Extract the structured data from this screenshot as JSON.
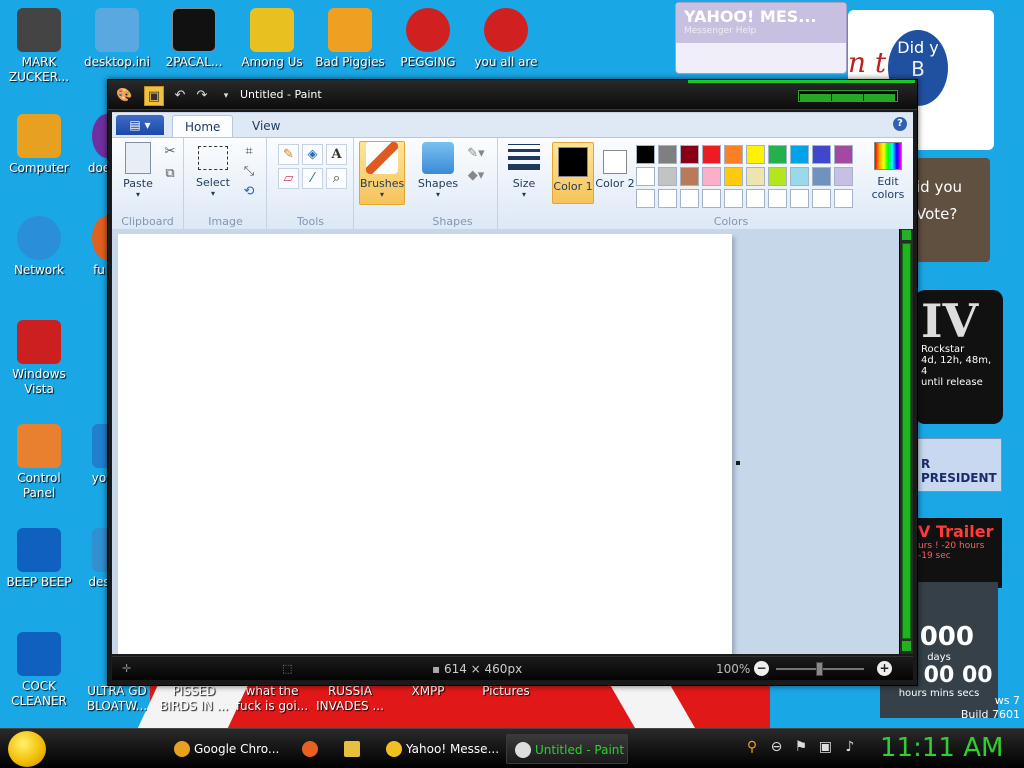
{
  "desktop": {
    "icons_left": [
      {
        "label": "MARK ZUCKER...",
        "color": "#444444"
      },
      {
        "label": "Computer",
        "color": "#e8a020"
      },
      {
        "label": "Network",
        "color": "#2a8fd8"
      },
      {
        "label": "Windows Vista",
        "color": "#cc2020"
      },
      {
        "label": "Control Panel",
        "color": "#e88030"
      },
      {
        "label": "BEEP BEEP",
        "color": "#1060c0"
      },
      {
        "label": "COCK CLEANER",
        "color": "#1060c0"
      }
    ],
    "icons_top": [
      {
        "label": "desktop.ini",
        "color": "#5aa8e0"
      },
      {
        "label": "2PACAL...",
        "color": "#111111"
      },
      {
        "label": "Among Us",
        "color": "#e8c020"
      },
      {
        "label": "Bad Piggies",
        "color": "#f0a020"
      },
      {
        "label": "PEGGING",
        "color": "#d02020"
      },
      {
        "label": "you all are",
        "color": "#d02020"
      }
    ],
    "icons_col2": [
      {
        "label": "doe",
        "color": "#7030a0"
      },
      {
        "label": "fu",
        "color": "#e06020"
      },
      {
        "label": "yo",
        "color": "#2080d0"
      },
      {
        "label": "des",
        "color": "#3090d0"
      }
    ],
    "icons_bottom": [
      {
        "label": "ULTRA GD BLOATW..."
      },
      {
        "label": "PISSED BIRDS IN ..."
      },
      {
        "label": "what the fuck is goi..."
      },
      {
        "label": "RUSSIA INVADES ..."
      },
      {
        "label": "XMPP"
      },
      {
        "label": "Pictures"
      }
    ]
  },
  "gadgets": {
    "yahoo_title": "YAHOO! MES...",
    "yahoo_sub": "Messenger   Help",
    "ad_text": "n t",
    "ad_circle": "Did y",
    "ad_circle_letter": "B",
    "vote_line1": "id you",
    "vote_line2": "Vote?",
    "gta_big": "IV",
    "gta_brand": "Rockstar",
    "gta_countdown": "4d, 12h, 48m, 4",
    "gta_until": "until release",
    "president": "R PRESIDENT",
    "trailer": "V Trailer",
    "trailer_countdown": "urs ! -20 hours",
    "trailer_countdown2": "-19 sec",
    "halo_number": "000",
    "halo_days": "days",
    "halo_time": "00 00 00",
    "halo_units": "hours mins secs",
    "build_line1": "ws 7",
    "build_line2": "Build 7601"
  },
  "paint": {
    "window_title": "Untitled - Paint",
    "file_menu": "▤ ▾",
    "tabs": {
      "home": "Home",
      "view": "View"
    },
    "help": "?",
    "groups": {
      "clipboard": {
        "label": "Clipboard",
        "paste": "Paste"
      },
      "image": {
        "label": "Image",
        "select": "Select"
      },
      "tools": {
        "label": "Tools"
      },
      "brushes": {
        "label": "Brushes"
      },
      "shapes": {
        "label": "Shapes",
        "shapes_btn": "Shapes"
      },
      "size": {
        "label": "Size"
      },
      "colors": {
        "label": "Colors",
        "color1": "Color 1",
        "color2": "Color 2",
        "color1_value": "#000000",
        "color2_value": "#ffffff",
        "edit": "Edit colors",
        "palette_row1": [
          "#000000",
          "#7f7f7f",
          "#880015",
          "#ed1c24",
          "#ff7f27",
          "#fff200",
          "#22b14c",
          "#00a2e8",
          "#3f48cc",
          "#a349a4"
        ],
        "palette_row2": [
          "#ffffff",
          "#c3c3c3",
          "#b97a57",
          "#ffaec9",
          "#ffc90e",
          "#efe4b0",
          "#b5e61d",
          "#99d9ea",
          "#7092be",
          "#c8bfe7"
        ],
        "palette_row3": [
          "#ffffff",
          "#ffffff",
          "#ffffff",
          "#ffffff",
          "#ffffff",
          "#ffffff",
          "#ffffff",
          "#ffffff",
          "#ffffff",
          "#ffffff"
        ]
      }
    },
    "status": {
      "canvas_size": "614 × 460px",
      "zoom": "100%"
    }
  },
  "taskbar": {
    "items": [
      {
        "label": "Google Chro...",
        "color": "#e8a020"
      },
      {
        "label": "",
        "color": "#e86020"
      },
      {
        "label": "",
        "color": "#e8c040"
      },
      {
        "label": "Yahoo! Messe...",
        "color": "#f0c020"
      },
      {
        "label": "Untitled - Paint",
        "color": "#dddddd"
      }
    ],
    "clock": "11:11 AM"
  }
}
